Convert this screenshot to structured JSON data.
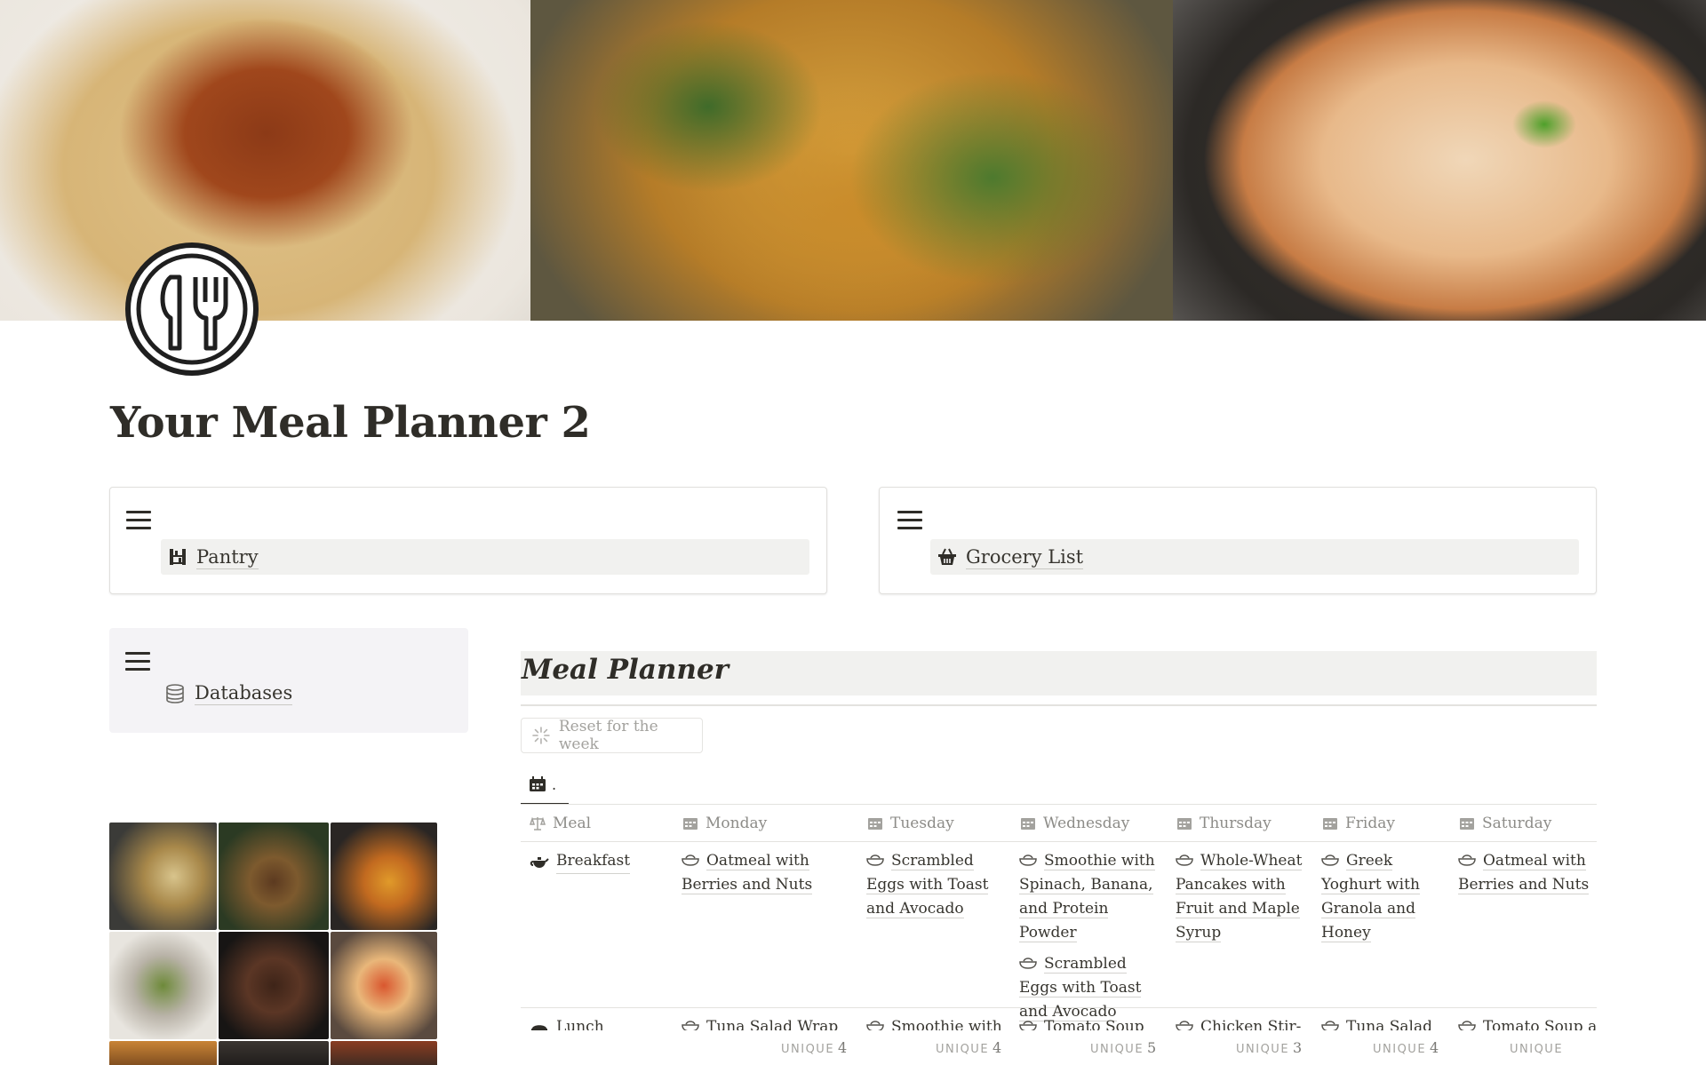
{
  "page": {
    "title": "Your Meal Planner 2"
  },
  "cover": {
    "images": [
      "spaghetti-bolognese",
      "vegetable-frittata",
      "skillet-casserole"
    ]
  },
  "links": {
    "pantry": "Pantry",
    "grocery": "Grocery List",
    "databases": "Databases"
  },
  "meal_planner": {
    "title": "Meal Planner",
    "reset_button": "Reset for the week",
    "view_tab_label": ".",
    "columns": [
      "Meal",
      "Monday",
      "Tuesday",
      "Wednesday",
      "Thursday",
      "Friday",
      "Saturday"
    ],
    "rows": [
      {
        "meal": "Breakfast",
        "cells": [
          [
            "Oatmeal with Berries and Nuts"
          ],
          [
            "Scrambled Eggs with Toast and Avocado"
          ],
          [
            "Smoothie with Spinach, Banana, and Protein Powder",
            "Scrambled Eggs with Toast and Avocado"
          ],
          [
            "Whole-Wheat Pancakes with Fruit and Maple Syrup"
          ],
          [
            "Greek Yoghurt with Granola and Honey"
          ],
          [
            "Oatmeal with Berries and Nuts"
          ]
        ]
      },
      {
        "meal": "Lunch",
        "cells": [
          [
            "Tuna Salad Wrap"
          ],
          [
            "Smoothie with"
          ],
          [
            "Tomato Soup"
          ],
          [
            "Chicken Stir-"
          ],
          [
            "Tuna Salad"
          ],
          [
            "Tomato Soup an"
          ]
        ]
      }
    ],
    "footer": {
      "label": "UNIQUE",
      "counts": [
        "4",
        "4",
        "5",
        "3",
        "4",
        ""
      ]
    }
  }
}
